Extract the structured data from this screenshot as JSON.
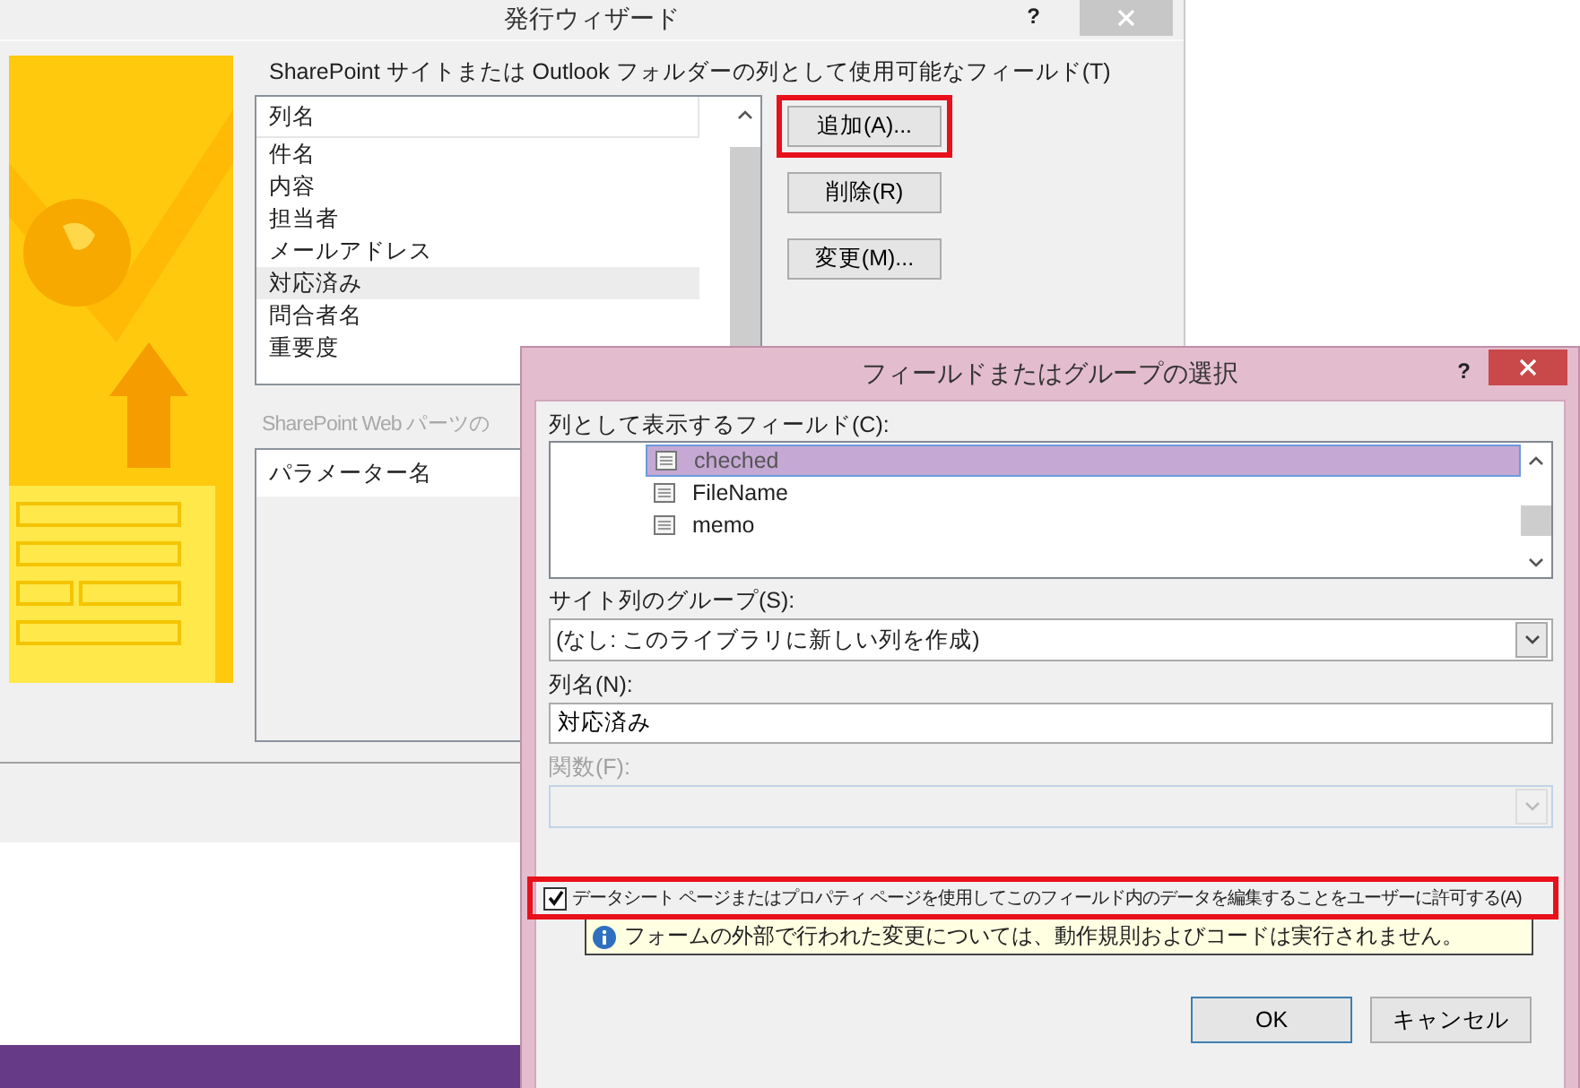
{
  "wizard": {
    "title": "発行ウィザード",
    "help": "?",
    "fields_label": "SharePoint サイトまたは Outlook フォルダーの列として使用可能なフィールド(T)",
    "columns_list": {
      "header": "列名",
      "items": [
        {
          "label": "件名",
          "selected": false
        },
        {
          "label": "内容",
          "selected": false
        },
        {
          "label": "担当者",
          "selected": false
        },
        {
          "label": "メールアドレス",
          "selected": false
        },
        {
          "label": "対応済み",
          "selected": true
        },
        {
          "label": "問合者名",
          "selected": false
        },
        {
          "label": "重要度",
          "selected": false
        }
      ]
    },
    "buttons": [
      {
        "label": "追加(A)...",
        "highlighted": true
      },
      {
        "label": "削除(R)",
        "highlighted": false
      },
      {
        "label": "変更(M)...",
        "highlighted": false
      }
    ],
    "webparts_label": "SharePoint Web パーツの",
    "params_list": {
      "header": "パラメーター名"
    }
  },
  "dialog": {
    "title": "フィールドまたはグループの選択",
    "help": "?",
    "fields_label": "列として表示するフィールド(C):",
    "fields": [
      {
        "label": "cheched",
        "selected": true
      },
      {
        "label": "FileName",
        "selected": false
      },
      {
        "label": "memo",
        "selected": false
      }
    ],
    "group_label": "サイト列のグループ(S):",
    "group_value": "(なし: このライブラリに新しい列を作成)",
    "name_label": "列名(N):",
    "name_value": "対応済み",
    "function_label": "関数(F):",
    "function_disabled": true,
    "allow_edit": {
      "label": "データシート ページまたはプロパティ ページを使用してこのフィールド内のデータを編集することをユーザーに許可する(A)",
      "checked": true,
      "highlighted": true
    },
    "info": "フォームの外部で行われた変更については、動作規則およびコードは実行されません。",
    "buttons": [
      "OK",
      "キャンセル"
    ]
  }
}
